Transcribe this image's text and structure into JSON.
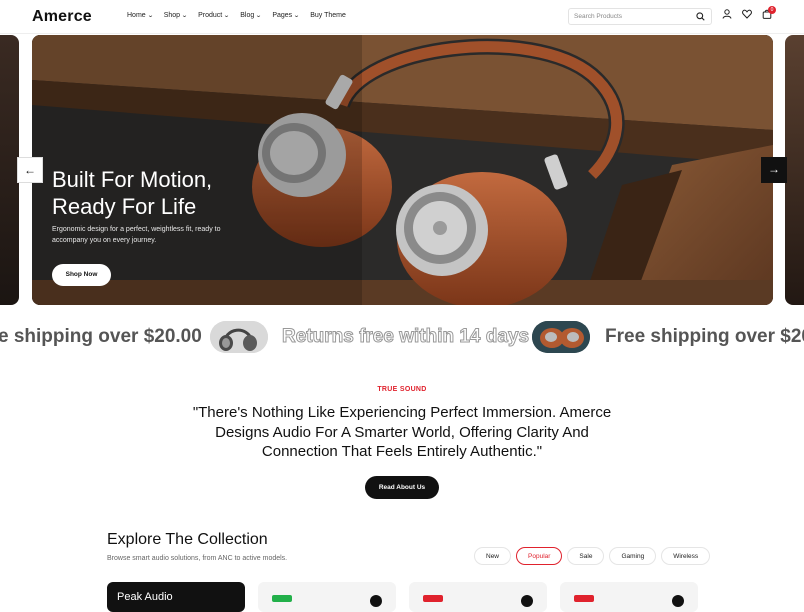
{
  "brand": {
    "logo": "Amerce"
  },
  "nav": [
    {
      "label": "Home",
      "has_dropdown": true
    },
    {
      "label": "Shop",
      "has_dropdown": true
    },
    {
      "label": "Product",
      "has_dropdown": true
    },
    {
      "label": "Blog",
      "has_dropdown": true
    },
    {
      "label": "Pages",
      "has_dropdown": true
    },
    {
      "label": "Buy Theme",
      "has_dropdown": false
    }
  ],
  "search": {
    "placeholder": "Search Products",
    "icon": "search-icon"
  },
  "header_icons": {
    "account": "user-icon",
    "wishlist": "heart-icon",
    "cart": "cart-icon",
    "cart_count": "0"
  },
  "hero": {
    "title_line1": "Built For Motion,",
    "title_line2": "Ready For Life",
    "subtitle_line1": "Ergonomic design for a perfect, weightless fit, ready to",
    "subtitle_line2": "accompany you on every journey.",
    "cta": "Shop Now",
    "prev_icon": "arrow-left-icon",
    "next_icon": "arrow-right-icon"
  },
  "marquee": {
    "item1": "e shipping over $20.00",
    "item2": "Returns free within 14 days",
    "item3": "Free shipping over $20"
  },
  "intro": {
    "eyebrow": "TRUE SOUND",
    "quote_line1": "\"There's Nothing Like Experiencing Perfect Immersion. Amerce",
    "quote_line2": "Designs Audio For A Smarter World, Offering Clarity And",
    "quote_line3": "Connection That Feels Entirely Authentic.\"",
    "cta": "Read About Us"
  },
  "collection": {
    "title": "Explore The Collection",
    "subtitle": "Browse smart audio solutions, from ANC to active models.",
    "tabs": [
      "New",
      "Popular",
      "Sale",
      "Gaming",
      "Wireless"
    ],
    "active_tab": "Popular",
    "first_card_title": "Peak Audio"
  },
  "colors": {
    "accent": "#e0222d",
    "dark": "#111111",
    "tag_green": "#22b04a"
  }
}
